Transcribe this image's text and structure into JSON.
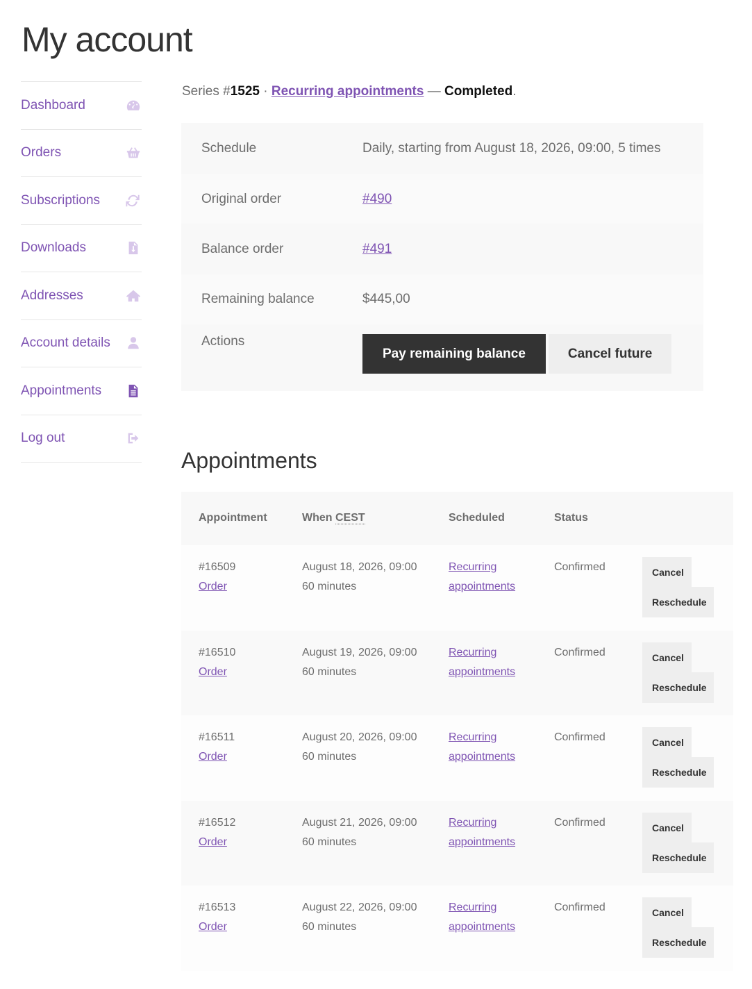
{
  "page": {
    "title": "My account"
  },
  "sidebar": {
    "items": [
      {
        "label": "Dashboard",
        "icon": "dashboard-icon"
      },
      {
        "label": "Orders",
        "icon": "basket-icon"
      },
      {
        "label": "Subscriptions",
        "icon": "refresh-icon"
      },
      {
        "label": "Downloads",
        "icon": "file-download-icon"
      },
      {
        "label": "Addresses",
        "icon": "home-icon"
      },
      {
        "label": "Account details",
        "icon": "user-icon"
      },
      {
        "label": "Appointments",
        "icon": "document-icon",
        "active": true
      },
      {
        "label": "Log out",
        "icon": "sign-out-icon"
      }
    ]
  },
  "series": {
    "prefix": "Series #",
    "number": "1525",
    "separator": " · ",
    "link": "Recurring appointments",
    "dash": " — ",
    "status": "Completed",
    "end": "."
  },
  "details": {
    "schedule_label": "Schedule",
    "schedule_value": "Daily, starting from August 18, 2026, 09:00, 5 times",
    "original_label": "Original order",
    "original_value": "#490",
    "balance_label": "Balance order",
    "balance_value": "#491",
    "remaining_label": "Remaining balance",
    "remaining_value": "$445,00",
    "actions_label": "Actions",
    "pay_button": "Pay remaining balance",
    "cancel_future_button": "Cancel future"
  },
  "appointments": {
    "heading": "Appointments",
    "columns": {
      "appointment": "Appointment",
      "when": "When ",
      "when_abbr": "CEST",
      "scheduled": "Scheduled",
      "status": "Status"
    },
    "rows": [
      {
        "id": "#16509",
        "order": "Order",
        "date": "August 18, 2026, 09:00",
        "duration": "60 minutes",
        "sched1": "Recurring",
        "sched2": "appointments",
        "status": "Confirmed",
        "cancel": "Cancel",
        "reschedule": "Reschedule"
      },
      {
        "id": "#16510",
        "order": "Order",
        "date": "August 19, 2026, 09:00",
        "duration": "60 minutes",
        "sched1": "Recurring",
        "sched2": "appointments",
        "status": "Confirmed",
        "cancel": "Cancel",
        "reschedule": "Reschedule"
      },
      {
        "id": "#16511",
        "order": "Order",
        "date": "August 20, 2026, 09:00",
        "duration": "60 minutes",
        "sched1": "Recurring",
        "sched2": "appointments",
        "status": "Confirmed",
        "cancel": "Cancel",
        "reschedule": "Reschedule"
      },
      {
        "id": "#16512",
        "order": "Order",
        "date": "August 21, 2026, 09:00",
        "duration": "60 minutes",
        "sched1": "Recurring",
        "sched2": "appointments",
        "status": "Confirmed",
        "cancel": "Cancel",
        "reschedule": "Reschedule"
      },
      {
        "id": "#16513",
        "order": "Order",
        "date": "August 22, 2026, 09:00",
        "duration": "60 minutes",
        "sched1": "Recurring",
        "sched2": "appointments",
        "status": "Confirmed",
        "cancel": "Cancel",
        "reschedule": "Reschedule"
      }
    ]
  },
  "colors": {
    "accent": "#7f54b3",
    "icon_muted": "#d8c7ea",
    "dark_button": "#333333",
    "light_button": "#eeeeee"
  }
}
